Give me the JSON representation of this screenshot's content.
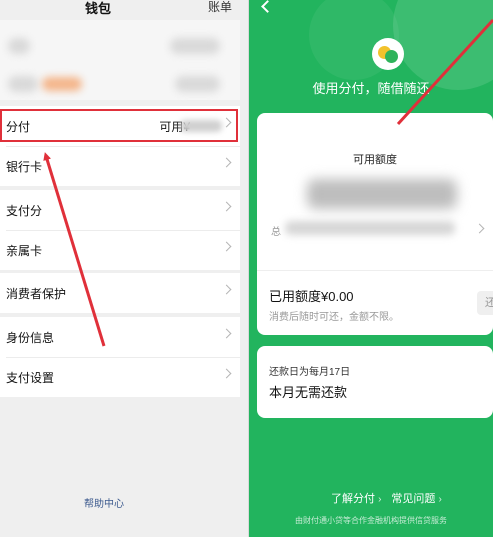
{
  "wallet": {
    "title": "钱包",
    "bill_label": "账单",
    "help_center": "帮助中心",
    "menu_groups": [
      [
        {
          "label": "分付",
          "available": "可用¥"
        },
        {
          "label": "银行卡"
        }
      ],
      [
        {
          "label": "支付分"
        },
        {
          "label": "亲属卡"
        }
      ],
      [
        {
          "label": "消费者保护"
        }
      ],
      [
        {
          "label": "身份信息"
        },
        {
          "label": "支付设置"
        }
      ]
    ]
  },
  "fenfu": {
    "slogan": "使用分付，随借随还",
    "available_label": "可用额度",
    "total_prefix": "总",
    "used_label": "已用额度¥0.00",
    "used_sub": "消费后随时可还，金额不限。",
    "repay_button": "还款",
    "due_line": "还款日为每月17日",
    "due_status": "本月无需还款",
    "links": [
      "了解分付",
      "常见问题"
    ],
    "footer": "由财付通小贷等合作金融机构提供信贷服务"
  },
  "colors": {
    "brand_green": "#22b45e",
    "highlight_red": "#e0303a"
  }
}
